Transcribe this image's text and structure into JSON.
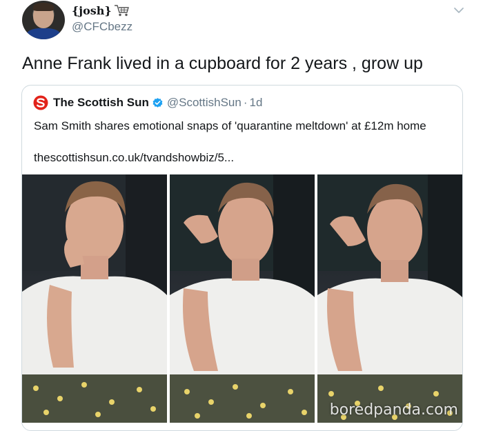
{
  "author": {
    "display_name": "{josh}",
    "handle": "@CFCbezz",
    "name_emoji_icon": "shopping-cart-icon",
    "more_icon": "chevron-down-icon"
  },
  "tweet": {
    "text": "Anne Frank lived in a cupboard for 2 years , grow up"
  },
  "quoted": {
    "source_name": "The Scottish Sun",
    "verified_icon": "verified-badge-icon",
    "handle": "@ScottishSun",
    "separator": "·",
    "age": "1d",
    "text": "Sam Smith shares emotional snaps of 'quarantine meltdown' at £12m home",
    "link": "thescottishsun.co.uk/tvandshowbiz/5..."
  },
  "watermark": "boredpanda.com",
  "colors": {
    "text": "#14171a",
    "secondary_text": "#657786",
    "border": "#cfd9de",
    "verified": "#1da1f2",
    "sun_logo": "#e2231a"
  }
}
